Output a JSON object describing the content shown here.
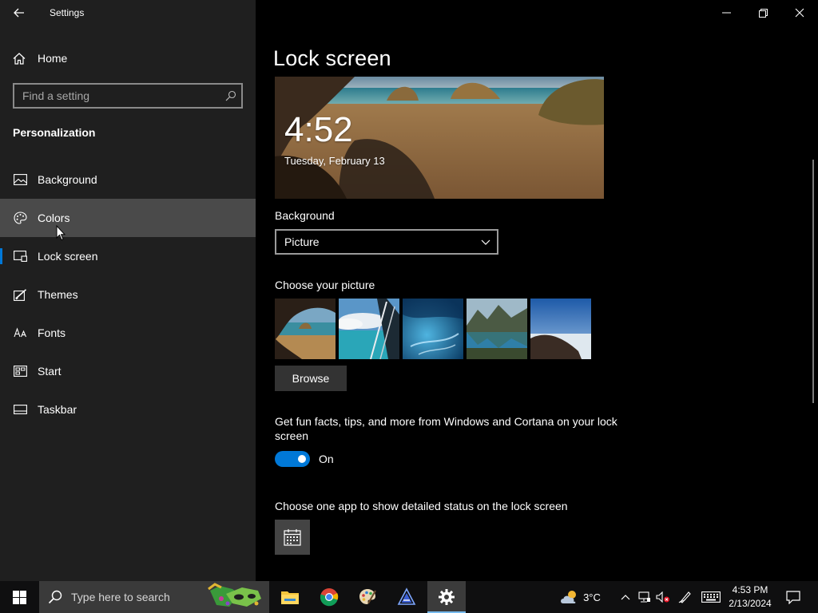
{
  "window": {
    "title": "Settings"
  },
  "sidebar": {
    "home_label": "Home",
    "search_placeholder": "Find a setting",
    "section_heading": "Personalization",
    "items": [
      {
        "label": "Background",
        "icon": "picture-icon"
      },
      {
        "label": "Colors",
        "icon": "palette-icon",
        "state": "hover"
      },
      {
        "label": "Lock screen",
        "icon": "lock-screen-icon",
        "state": "selected"
      },
      {
        "label": "Themes",
        "icon": "brush-icon"
      },
      {
        "label": "Fonts",
        "icon": "font-icon"
      },
      {
        "label": "Start",
        "icon": "start-icon"
      },
      {
        "label": "Taskbar",
        "icon": "taskbar-icon"
      }
    ]
  },
  "main": {
    "title": "Lock screen",
    "preview": {
      "time": "4:52",
      "date": "Tuesday, February 13"
    },
    "background_label": "Background",
    "background_value": "Picture",
    "choose_picture_label": "Choose your picture",
    "browse_label": "Browse",
    "tips_text": "Get fun facts, tips, and more from Windows and Cortana on your lock screen",
    "toggle_state": "On",
    "detailed_status_label": "Choose one app to show detailed status on the lock screen"
  },
  "taskbar": {
    "search_placeholder": "Type here to search",
    "weather_temp": "3°C",
    "clock_time": "4:53 PM",
    "clock_date": "2/13/2024"
  },
  "colors": {
    "accent": "#0078d7",
    "sidebar_bg": "#1f1f1f",
    "hover_bg": "#4a4a4a",
    "content_bg": "#000000"
  }
}
